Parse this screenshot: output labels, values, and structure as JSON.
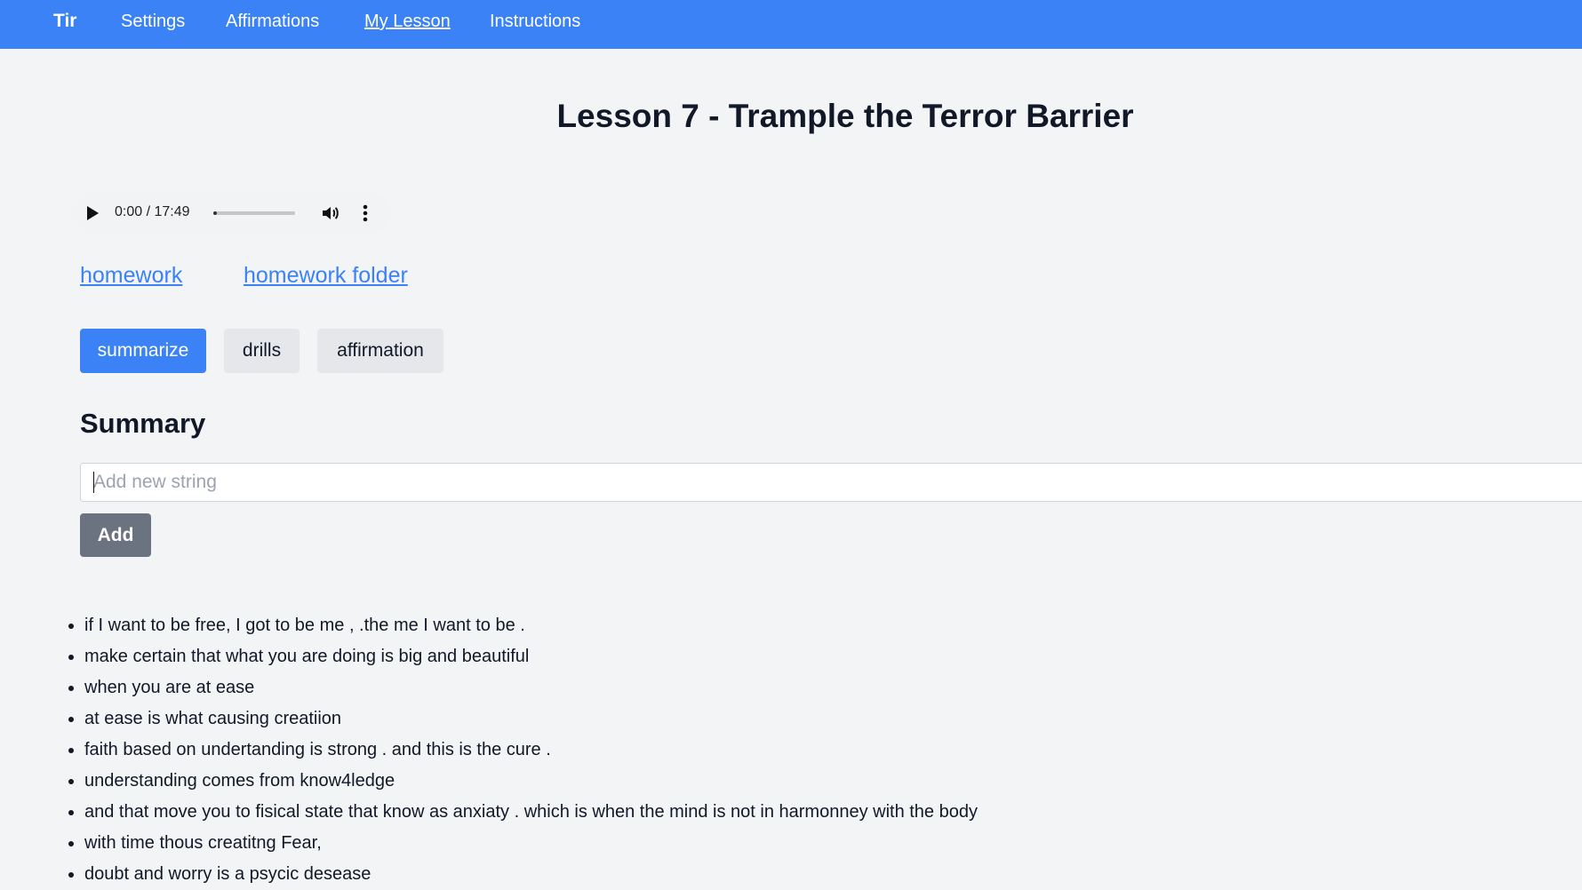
{
  "nav": {
    "brand": "Tir",
    "links": [
      "Settings",
      "Affirmations",
      "My Lesson",
      "Instructions"
    ],
    "active": "My Lesson"
  },
  "page": {
    "title": "Lesson 7 - Trample the Terror Barrier"
  },
  "audio": {
    "time": "0:00 / 17:49",
    "progress_fraction": 0.0
  },
  "links": {
    "homework": "homework",
    "homework_folder": "homework folder"
  },
  "tabs": {
    "summarize": "summarize",
    "drills": "drills",
    "affirmation": "affirmation",
    "selected": "summarize"
  },
  "summary": {
    "title": "Summary",
    "input_placeholder": "Add new string",
    "input_value": "",
    "add_label": "Add",
    "items": [
      "if I want to be free, I got to be me , .the me I want to be .",
      "make certain that what you are doing is big and beautiful",
      "when you are at ease",
      "at ease is what causing creatiion",
      "faith based on undertanding is strong . and this is the cure .",
      "understanding comes from know4ledge",
      "and that move you to fisical state that know as anxiaty . which is when the mind is not in harmonney with the body",
      "with time thous creatitng Fear,",
      "doubt and worry is a psycic desease"
    ]
  },
  "colors": {
    "nav_bg": "#3b82f6",
    "primary": "#3b82f6",
    "secondary": "#e5e7eb",
    "add_button": "#6b7280",
    "page_bg": "#f3f4f6"
  }
}
